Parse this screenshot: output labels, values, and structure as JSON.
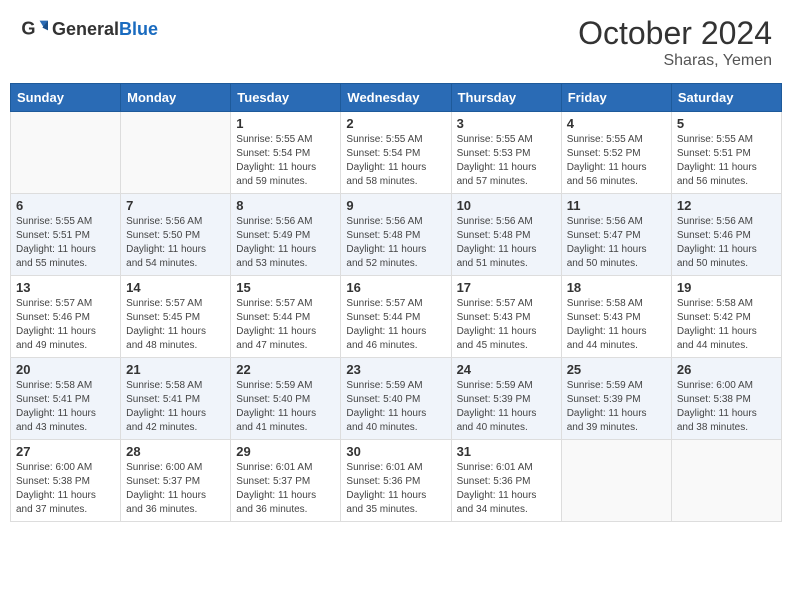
{
  "header": {
    "logo_general": "General",
    "logo_blue": "Blue",
    "month_year": "October 2024",
    "location": "Sharas, Yemen"
  },
  "days_of_week": [
    "Sunday",
    "Monday",
    "Tuesday",
    "Wednesday",
    "Thursday",
    "Friday",
    "Saturday"
  ],
  "weeks": [
    [
      {
        "day": "",
        "info": ""
      },
      {
        "day": "",
        "info": ""
      },
      {
        "day": "1",
        "info": "Sunrise: 5:55 AM\nSunset: 5:54 PM\nDaylight: 11 hours and 59 minutes."
      },
      {
        "day": "2",
        "info": "Sunrise: 5:55 AM\nSunset: 5:54 PM\nDaylight: 11 hours and 58 minutes."
      },
      {
        "day": "3",
        "info": "Sunrise: 5:55 AM\nSunset: 5:53 PM\nDaylight: 11 hours and 57 minutes."
      },
      {
        "day": "4",
        "info": "Sunrise: 5:55 AM\nSunset: 5:52 PM\nDaylight: 11 hours and 56 minutes."
      },
      {
        "day": "5",
        "info": "Sunrise: 5:55 AM\nSunset: 5:51 PM\nDaylight: 11 hours and 56 minutes."
      }
    ],
    [
      {
        "day": "6",
        "info": "Sunrise: 5:55 AM\nSunset: 5:51 PM\nDaylight: 11 hours and 55 minutes."
      },
      {
        "day": "7",
        "info": "Sunrise: 5:56 AM\nSunset: 5:50 PM\nDaylight: 11 hours and 54 minutes."
      },
      {
        "day": "8",
        "info": "Sunrise: 5:56 AM\nSunset: 5:49 PM\nDaylight: 11 hours and 53 minutes."
      },
      {
        "day": "9",
        "info": "Sunrise: 5:56 AM\nSunset: 5:48 PM\nDaylight: 11 hours and 52 minutes."
      },
      {
        "day": "10",
        "info": "Sunrise: 5:56 AM\nSunset: 5:48 PM\nDaylight: 11 hours and 51 minutes."
      },
      {
        "day": "11",
        "info": "Sunrise: 5:56 AM\nSunset: 5:47 PM\nDaylight: 11 hours and 50 minutes."
      },
      {
        "day": "12",
        "info": "Sunrise: 5:56 AM\nSunset: 5:46 PM\nDaylight: 11 hours and 50 minutes."
      }
    ],
    [
      {
        "day": "13",
        "info": "Sunrise: 5:57 AM\nSunset: 5:46 PM\nDaylight: 11 hours and 49 minutes."
      },
      {
        "day": "14",
        "info": "Sunrise: 5:57 AM\nSunset: 5:45 PM\nDaylight: 11 hours and 48 minutes."
      },
      {
        "day": "15",
        "info": "Sunrise: 5:57 AM\nSunset: 5:44 PM\nDaylight: 11 hours and 47 minutes."
      },
      {
        "day": "16",
        "info": "Sunrise: 5:57 AM\nSunset: 5:44 PM\nDaylight: 11 hours and 46 minutes."
      },
      {
        "day": "17",
        "info": "Sunrise: 5:57 AM\nSunset: 5:43 PM\nDaylight: 11 hours and 45 minutes."
      },
      {
        "day": "18",
        "info": "Sunrise: 5:58 AM\nSunset: 5:43 PM\nDaylight: 11 hours and 44 minutes."
      },
      {
        "day": "19",
        "info": "Sunrise: 5:58 AM\nSunset: 5:42 PM\nDaylight: 11 hours and 44 minutes."
      }
    ],
    [
      {
        "day": "20",
        "info": "Sunrise: 5:58 AM\nSunset: 5:41 PM\nDaylight: 11 hours and 43 minutes."
      },
      {
        "day": "21",
        "info": "Sunrise: 5:58 AM\nSunset: 5:41 PM\nDaylight: 11 hours and 42 minutes."
      },
      {
        "day": "22",
        "info": "Sunrise: 5:59 AM\nSunset: 5:40 PM\nDaylight: 11 hours and 41 minutes."
      },
      {
        "day": "23",
        "info": "Sunrise: 5:59 AM\nSunset: 5:40 PM\nDaylight: 11 hours and 40 minutes."
      },
      {
        "day": "24",
        "info": "Sunrise: 5:59 AM\nSunset: 5:39 PM\nDaylight: 11 hours and 40 minutes."
      },
      {
        "day": "25",
        "info": "Sunrise: 5:59 AM\nSunset: 5:39 PM\nDaylight: 11 hours and 39 minutes."
      },
      {
        "day": "26",
        "info": "Sunrise: 6:00 AM\nSunset: 5:38 PM\nDaylight: 11 hours and 38 minutes."
      }
    ],
    [
      {
        "day": "27",
        "info": "Sunrise: 6:00 AM\nSunset: 5:38 PM\nDaylight: 11 hours and 37 minutes."
      },
      {
        "day": "28",
        "info": "Sunrise: 6:00 AM\nSunset: 5:37 PM\nDaylight: 11 hours and 36 minutes."
      },
      {
        "day": "29",
        "info": "Sunrise: 6:01 AM\nSunset: 5:37 PM\nDaylight: 11 hours and 36 minutes."
      },
      {
        "day": "30",
        "info": "Sunrise: 6:01 AM\nSunset: 5:36 PM\nDaylight: 11 hours and 35 minutes."
      },
      {
        "day": "31",
        "info": "Sunrise: 6:01 AM\nSunset: 5:36 PM\nDaylight: 11 hours and 34 minutes."
      },
      {
        "day": "",
        "info": ""
      },
      {
        "day": "",
        "info": ""
      }
    ]
  ]
}
